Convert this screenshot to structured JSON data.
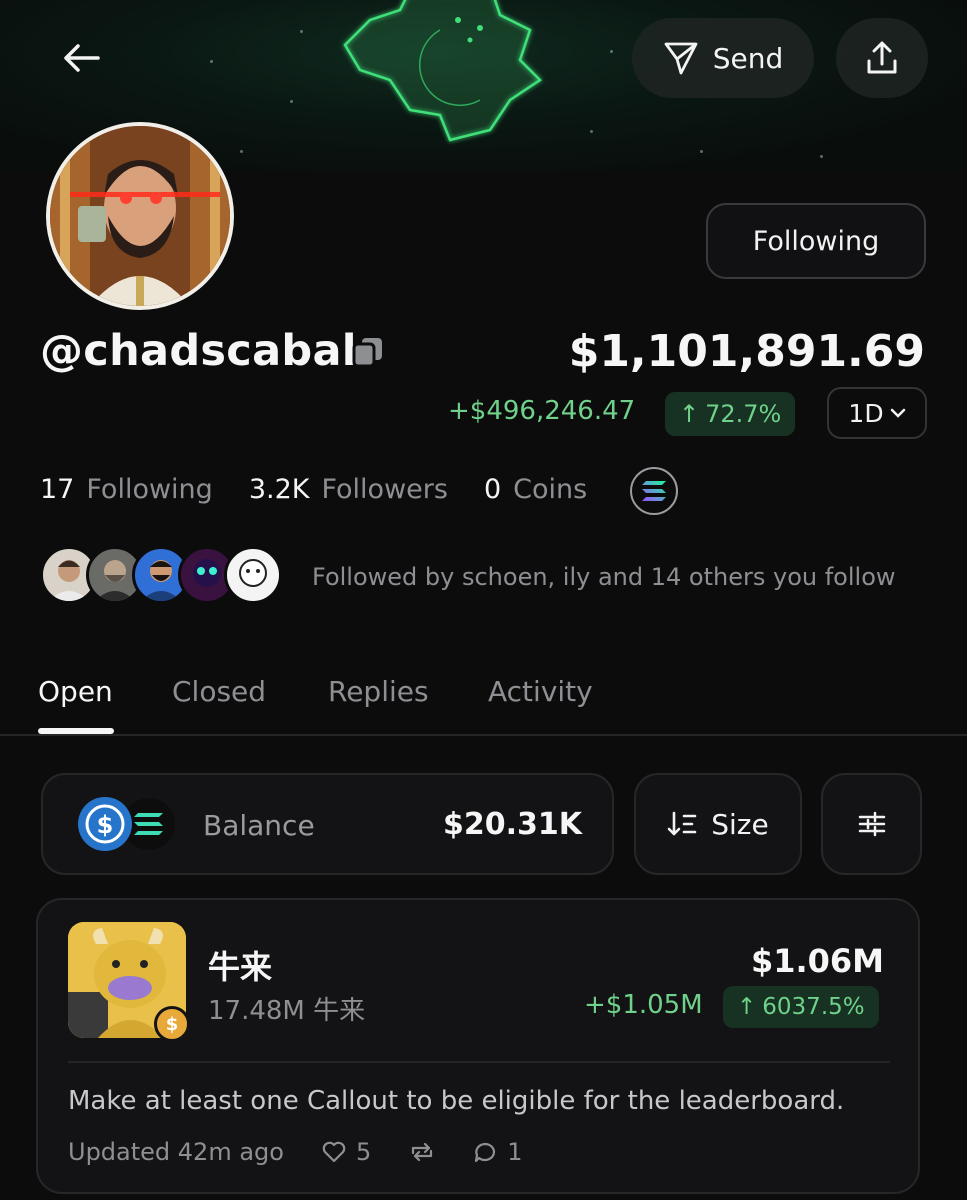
{
  "header": {
    "send_label": "Send"
  },
  "profile": {
    "following_button": "Following",
    "handle": "@chadscabal",
    "portfolio_value": "$1,101,891.69",
    "pnl_value": "+$496,246.47",
    "pnl_percent": "72.7%",
    "range": "1D",
    "stats": [
      {
        "count": "17",
        "label": "Following"
      },
      {
        "count": "3.2K",
        "label": "Followers"
      },
      {
        "count": "0",
        "label": "Coins"
      }
    ],
    "mutual_text": "Followed by schoen, ily and 14 others you follow"
  },
  "tabs": [
    "Open",
    "Closed",
    "Replies",
    "Activity"
  ],
  "balance": {
    "label": "Balance",
    "value": "$20.31K"
  },
  "sort": {
    "label": "Size"
  },
  "position": {
    "name": "牛来",
    "amount": "17.48M 牛来",
    "value": "$1.06M",
    "pnl": "+$1.05M",
    "pnl_percent": "6037.5%",
    "coin_badge": "$",
    "message": "Make at least one Callout to be eligible for the leaderboard.",
    "updated": "Updated 42m ago",
    "likes": "5",
    "comments": "1"
  },
  "colors": {
    "accent_green": "#6fd18a",
    "background": "#0c0c0d",
    "card": "#131315"
  }
}
